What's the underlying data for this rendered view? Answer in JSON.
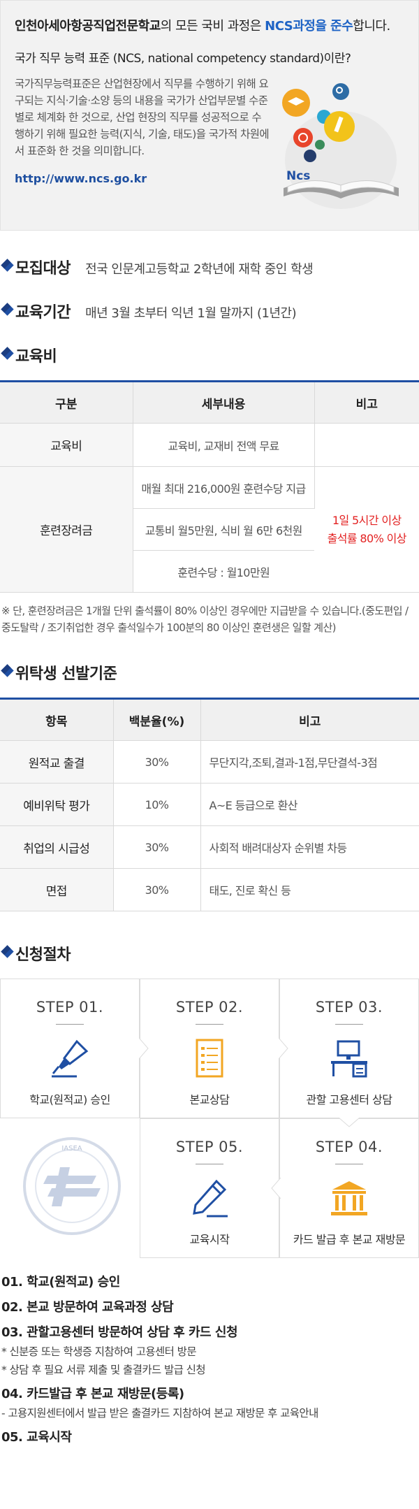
{
  "intro": {
    "school_name": "인천아세아항공직업전문학교",
    "headline_mid": "의 모든 국비 과정은 ",
    "headline_em": "NCS과정을 준수",
    "headline_end": "합니다.",
    "question": "국가 직무 능력 표준 (NCS, national competency standard)이란?",
    "description": "국가직무능력표준은 산업현장에서 직무를 수행하기 위해 요구되는 지식·기술·소양 등의 내용을 국가가 산업부문별 수준별로 체계화 한 것으로, 산업 현장의 직무를 성공적으로 수행하기 위해 필요한 능력(지식, 기술, 태도)을 국가적 차원에서 표준화 한 것을 의미합니다.",
    "link": "http://www.ncs.go.kr",
    "logo_text": "Ncs"
  },
  "recruit": {
    "title": "모집대상",
    "value": "전국 인문계고등학교 2학년에 재학 중인 학생"
  },
  "period": {
    "title": "교육기간",
    "value": "매년 3월 초부터 익년 1월 말까지 (1년간)"
  },
  "fee": {
    "title": "교육비",
    "headers": [
      "구분",
      "세부내용",
      "비고"
    ],
    "row1": {
      "label": "교육비",
      "detail": "교육비, 교재비 전액 무료",
      "note": ""
    },
    "row2": {
      "label": "훈련장려금",
      "details": [
        "매월 최대 216,000원 훈련수당 지급",
        "교통비 월5만원, 식비 월 6만 6천원",
        "훈련수당 : 월10만원"
      ],
      "note_line1": "1일 5시간 이상",
      "note_line2": "출석률 80% 이상"
    },
    "footnote": "※ 단, 훈련장려금은 1개월 단위 출석률이 80% 이상인 경우에만 지급받을 수 있습니다.(중도편입 / 중도탈락 / 조기취업한 경우 출석일수가 100분의 80 이상인 훈련생은 일할 계산)"
  },
  "selection": {
    "title": "위탁생 선발기준",
    "headers": [
      "항목",
      "백분율(%)",
      "비고"
    ],
    "rows": [
      {
        "item": "원적교 출결",
        "pct": "30%",
        "note": "무단지각,조퇴,결과-1점,무단결석-3점"
      },
      {
        "item": "예비위탁 평가",
        "pct": "10%",
        "note": "A~E 등급으로 환산"
      },
      {
        "item": "취업의 시급성",
        "pct": "30%",
        "note": "사회적 배려대상자 순위별 차등"
      },
      {
        "item": "면접",
        "pct": "30%",
        "note": "태도, 진로 확신 등"
      }
    ]
  },
  "procedure": {
    "title": "신청절차",
    "steps": [
      {
        "step": "STEP 01.",
        "label": "학교(원적교) 승인",
        "icon": "fountain-pen-icon"
      },
      {
        "step": "STEP 02.",
        "label": "본교상담",
        "icon": "document-list-icon"
      },
      {
        "step": "STEP 03.",
        "label": "관할 고용센터 상담",
        "icon": "office-desk-icon"
      },
      {
        "step": "STEP 04.",
        "label": "카드 발급 후 본교 재방문",
        "icon": "building-pillars-icon"
      },
      {
        "step": "STEP 05.",
        "label": "교육시작",
        "icon": "pencil-icon"
      }
    ],
    "emblem_text": "IASEA",
    "details": [
      {
        "heading": "01. 학교(원적교) 승인",
        "subs": []
      },
      {
        "heading": "02. 본교 방문하여 교육과정 상담",
        "subs": []
      },
      {
        "heading": "03. 관할고용센터 방문하여 상담 후 카드 신청",
        "subs": [
          "* 신분증 또는 학생증 지참하여 고용센터 방문",
          "* 상담 후 필요 서류 제출 및 출결카드 발급 신청"
        ]
      },
      {
        "heading": "04. 카드발급 후 본교 재방문(등록)",
        "subs": [
          "- 고용지원센터에서 발급 받은 출결카드 지참하여 본교 재방문 후 교육안내"
        ]
      },
      {
        "heading": "05. 교육시작",
        "subs": []
      }
    ]
  },
  "colors": {
    "accent": "#1f4fa3",
    "link": "#1e63c5",
    "warn": "#e32222"
  }
}
